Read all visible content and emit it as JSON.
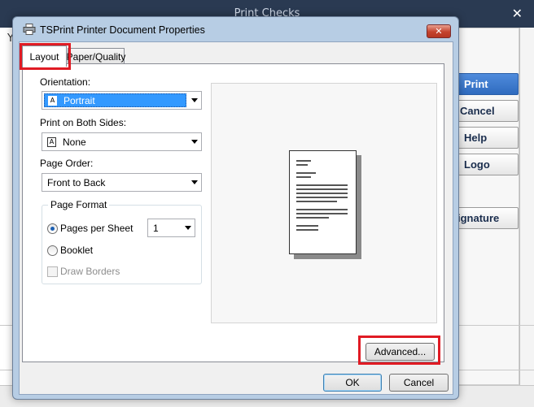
{
  "background_window": {
    "title": "Print Checks",
    "close_glyph": "✕",
    "left_char": "Y",
    "buttons": {
      "print": "Print",
      "cancel": "Cancel",
      "help": "Help",
      "logo": "Logo",
      "signature": "ignature"
    }
  },
  "dialog": {
    "title": "TSPrint Printer Document Properties",
    "close_glyph": "✕",
    "icon": "printer-icon",
    "tabs": [
      {
        "label": "Layout",
        "selected": true
      },
      {
        "label": "Paper/Quality",
        "selected": false
      }
    ],
    "orientation": {
      "label": "Orientation:",
      "value": "Portrait",
      "value_icon": "A"
    },
    "both_sides": {
      "label": "Print on Both Sides:",
      "value": "None",
      "value_icon": "A"
    },
    "page_order": {
      "label": "Page Order:",
      "value": "Front to Back"
    },
    "page_format": {
      "legend": "Page Format",
      "pages_per_sheet_label": "Pages per Sheet",
      "pages_per_sheet_value": "1",
      "booklet_label": "Booklet",
      "draw_borders_label": "Draw Borders",
      "selected": "pages_per_sheet"
    },
    "advanced_button": "Advanced...",
    "ok_button": "OK",
    "cancel_button": "Cancel",
    "highlight_color": "#e01b24"
  }
}
